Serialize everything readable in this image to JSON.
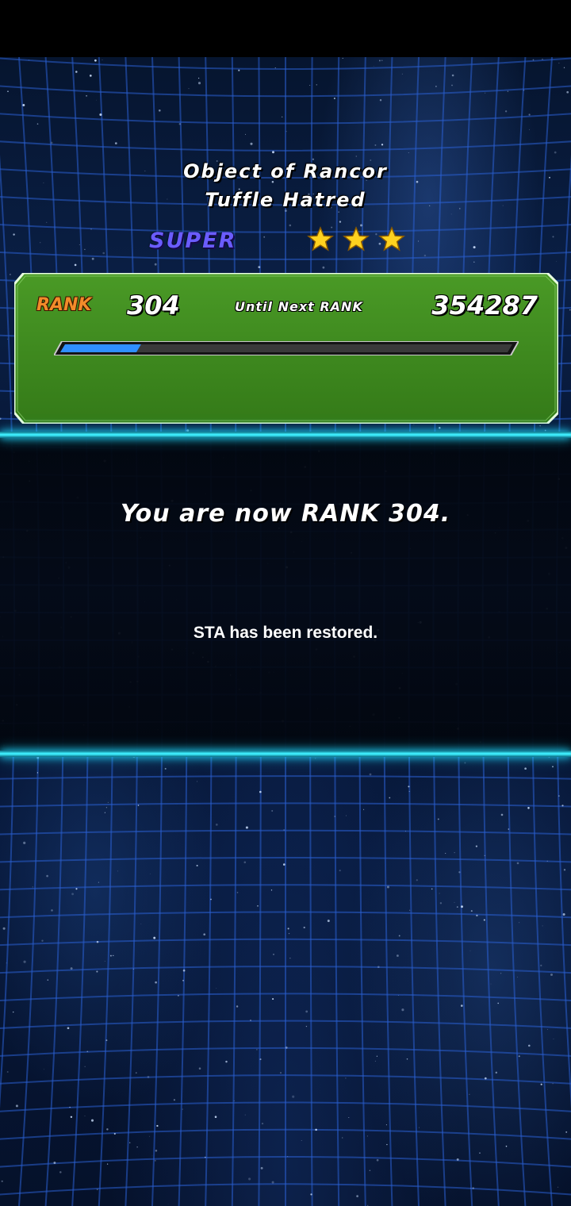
{
  "title": {
    "line1": "Object of Rancor",
    "line2": "Tuffle Hatred"
  },
  "rarity": {
    "label": "SUPER",
    "color": "#6a5cff",
    "stars": 3
  },
  "rank_panel": {
    "rank_label": "RANK",
    "rank_value": "304",
    "next_label": "Until Next RANK",
    "next_value": "354287",
    "progress_fraction": 0.17,
    "panel_color": "#3f8f1f",
    "bar_fill_color": "#2f8fff"
  },
  "message": {
    "main": "You are now RANK 304.",
    "sub": "STA has been restored."
  },
  "colors": {
    "accent_cyan": "#3ff0ff",
    "grid_blue": "#2a5fd0"
  },
  "icons": {
    "star": "star-icon"
  }
}
